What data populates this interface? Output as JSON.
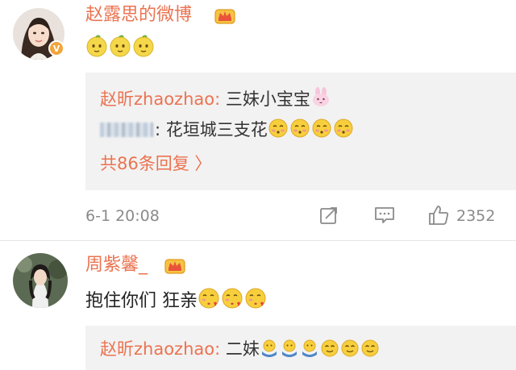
{
  "comments": [
    {
      "username": "赵露思的微博",
      "verified_badge": "V",
      "content_emojis": [
        "yellow-face-emoji",
        "yellow-face-emoji",
        "yellow-face-emoji"
      ],
      "replies": [
        {
          "name": "赵昕zhaozhao:",
          "text": "三妹小宝宝",
          "emojis": [
            "pink-bunny-emoji"
          ]
        },
        {
          "name": "",
          "text": ": 花垣城三支花",
          "emojis": [
            "blushing-face-emoji",
            "blushing-face-emoji",
            "blushing-face-emoji",
            "blushing-face-emoji"
          ]
        }
      ],
      "more_replies": "共86条回复 〉",
      "time": "6-1 20:08",
      "likes": "2352"
    },
    {
      "username": "周紫馨_",
      "text": "抱住你们 狂亲",
      "content_emojis": [
        "kiss-face-emoji",
        "kiss-face-emoji",
        "kiss-face-emoji"
      ],
      "replies": [
        {
          "name": "赵昕zhaozhao:",
          "text": "二妹",
          "emojis": [
            "hug-emoji",
            "hug-emoji",
            "hug-emoji",
            "smile-face-emoji",
            "smile-face-emoji",
            "smile-face-emoji"
          ]
        }
      ]
    }
  ],
  "colors": {
    "accent": "#eb7350",
    "reply_bg": "#f2f2f2",
    "meta": "#8a8a8a"
  },
  "icons": [
    "forward-icon",
    "comment-icon",
    "like-icon",
    "crown-badge-icon"
  ]
}
